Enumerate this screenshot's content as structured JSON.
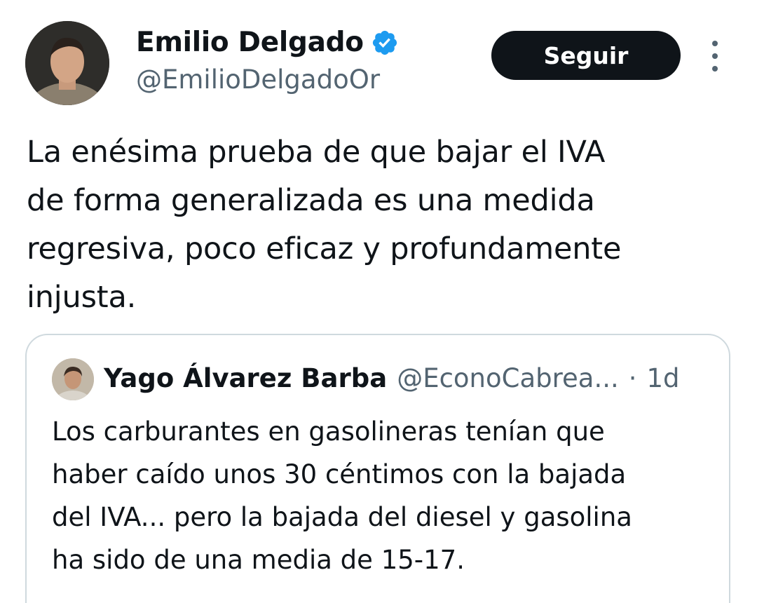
{
  "tweet": {
    "author": {
      "name": "Emilio Delgado",
      "handle": "@EmilioDelgadoOr",
      "verified": true,
      "avatar_icon": "person-avatar"
    },
    "follow_label": "Seguir",
    "more_icon": "more-vertical-icon",
    "text": "La enésima prueba de que bajar el IVA\nde forma generalizada es una medida\nregresiva, poco eficaz y profundamente\ninjusta.",
    "quoted": {
      "name": "Yago Álvarez Barba",
      "handle": "@EconoCabrea...",
      "separator": "·",
      "time": "1d",
      "text": "Los carburantes en gasolineras tenían que\nhaber caído unos 30 céntimos con la bajada\ndel IVA... pero la bajada del diesel y gasolina\nha sido de una media de 15-17."
    }
  },
  "colors": {
    "text_primary": "#0f1419",
    "text_secondary": "#536471",
    "verified_blue": "#1d9bf0",
    "button_bg": "#0f1419",
    "border": "#cfd9de"
  }
}
